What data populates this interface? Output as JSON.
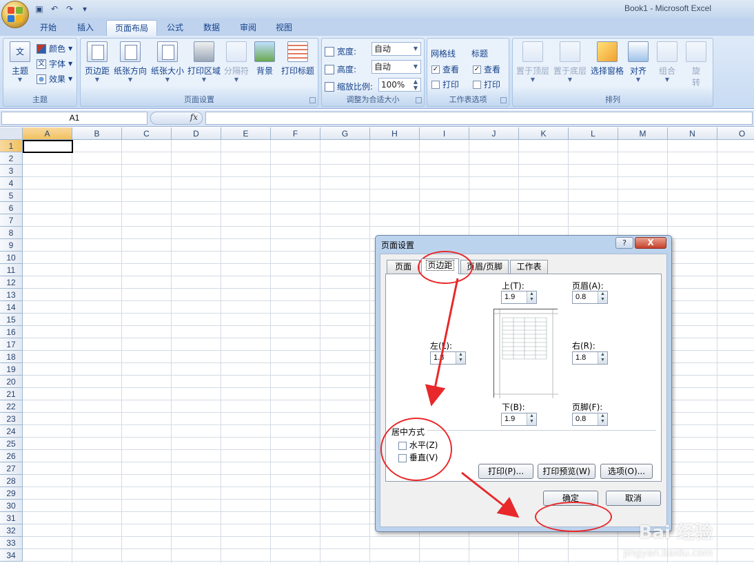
{
  "window": {
    "title": "Book1 - Microsoft Excel"
  },
  "ribbon": {
    "tabs": [
      {
        "label": "开始"
      },
      {
        "label": "插入"
      },
      {
        "label": "页面布局",
        "active": true
      },
      {
        "label": "公式"
      },
      {
        "label": "数据"
      },
      {
        "label": "审阅"
      },
      {
        "label": "视图"
      }
    ],
    "theme": {
      "label": "主题",
      "group": "主题",
      "colors": "颜色",
      "fonts": "字体",
      "effects": "效果"
    },
    "page_setup": {
      "group": "页面设置",
      "margins": "页边距",
      "orientation": "纸张方向",
      "size": "纸张大小",
      "print_area": "打印区域",
      "breaks": "分隔符",
      "background": "背景",
      "print_titles": "打印标题"
    },
    "scale_to_fit": {
      "group": "调整为合适大小",
      "width_label": "宽度:",
      "width_value": "自动",
      "height_label": "高度:",
      "height_value": "自动",
      "scale_label": "缩放比例:",
      "scale_value": "100%"
    },
    "sheet_options": {
      "group": "工作表选项",
      "gridlines": "网格线",
      "headings": "标题",
      "view": "查看",
      "print": "打印"
    },
    "arrange": {
      "group": "排列",
      "bring_front": "置于顶层",
      "send_back": "置于底层",
      "selection_pane": "选择窗格",
      "align": "对齐",
      "group_btn": "组合",
      "rotate_1": "旋",
      "rotate_2": "转"
    }
  },
  "formula_bar": {
    "name_box": "A1",
    "fx": "fx"
  },
  "sheet": {
    "columns": [
      "A",
      "B",
      "C",
      "D",
      "E",
      "F",
      "G",
      "H",
      "I",
      "J",
      "K",
      "L",
      "M",
      "N",
      "O"
    ],
    "rows": [
      "1",
      "2",
      "3",
      "4",
      "5",
      "6",
      "7",
      "8",
      "9",
      "10",
      "11",
      "12",
      "13",
      "14",
      "15",
      "16",
      "17",
      "18",
      "19",
      "20",
      "21",
      "22",
      "23",
      "24",
      "25",
      "26",
      "27",
      "28",
      "29",
      "30",
      "31",
      "32",
      "33",
      "34"
    ]
  },
  "dialog": {
    "title": "页面设置",
    "help": "?",
    "close": "X",
    "tabs": [
      "页面",
      "页边距",
      "页眉/页脚",
      "工作表"
    ],
    "top_label": "上(T):",
    "top_value": "1.9",
    "header_label": "页眉(A):",
    "header_value": "0.8",
    "left_label": "左(L):",
    "left_value": "1.8",
    "right_label": "右(R):",
    "right_value": "1.8",
    "bottom_label": "下(B):",
    "bottom_value": "1.9",
    "footer_label": "页脚(F):",
    "footer_value": "0.8",
    "center_title": "居中方式",
    "horizontal": "水平(Z)",
    "vertical": "垂直(V)",
    "print_btn": "打印(P)...",
    "preview_btn": "打印预览(W)",
    "options_btn": "选项(O)...",
    "ok_btn": "确定",
    "cancel_btn": "取消"
  },
  "watermark": {
    "brand": "Bai 经验",
    "url": "jingyan.baidu.com"
  },
  "colors": {
    "annotation": "#e8282a",
    "ribbon_text": "#15428b"
  }
}
